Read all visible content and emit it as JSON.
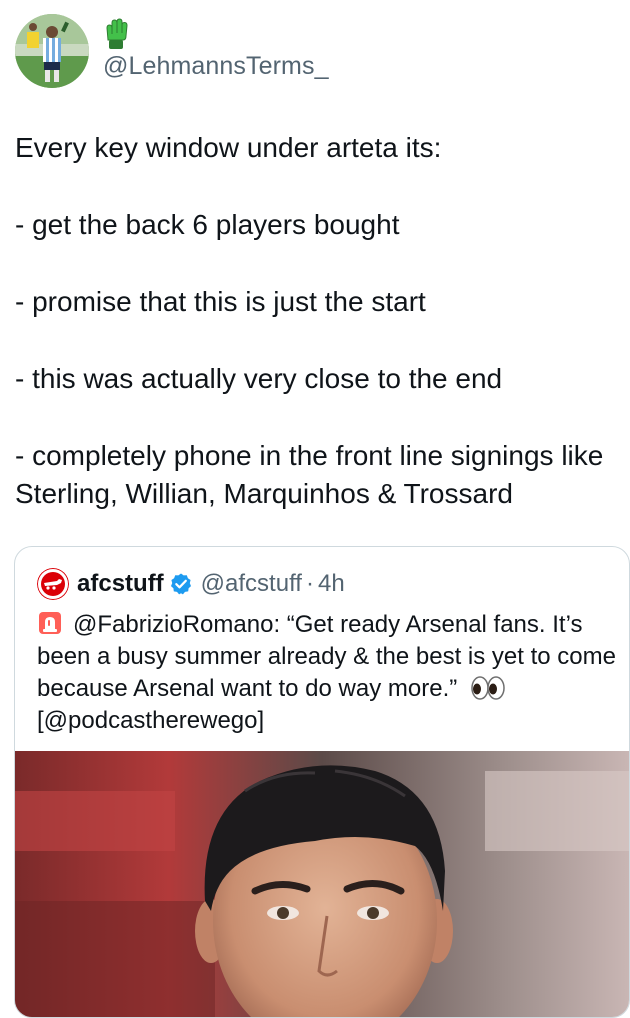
{
  "author": {
    "handle": "@LehmannsTerms_",
    "name_icon": "goalkeeper-glove-emoji"
  },
  "tweet": {
    "lines": [
      "Every key window under arteta its:",
      "- get the back 6 players bought",
      "- promise that this is just the start",
      "- this was actually very close to the end",
      "- completely phone in the front line signings like Sterling, Willian, Marquinhos & Trossard"
    ]
  },
  "quoted_tweet": {
    "name": "afcstuff",
    "verified": true,
    "handle": "@afcstuff",
    "separator": "·",
    "time": "4h",
    "text_before_icon": "",
    "text": "@FabrizioRomano: “Get ready Arsenal fans. It’s been a busy summer already & the best is yet to come because Arsenal want to do way more.”",
    "text_after": "[@podcastherewego]",
    "leading_icon": "police-siren-emoji",
    "trailing_icon": "eyes-emoji",
    "media": "photo-of-man-with-dark-hair"
  },
  "colors": {
    "text_primary": "#0f1419",
    "text_secondary": "#536471",
    "border": "#cfd9de",
    "verified_blue": "#1d9bf0",
    "arsenal_red": "#db0007"
  }
}
